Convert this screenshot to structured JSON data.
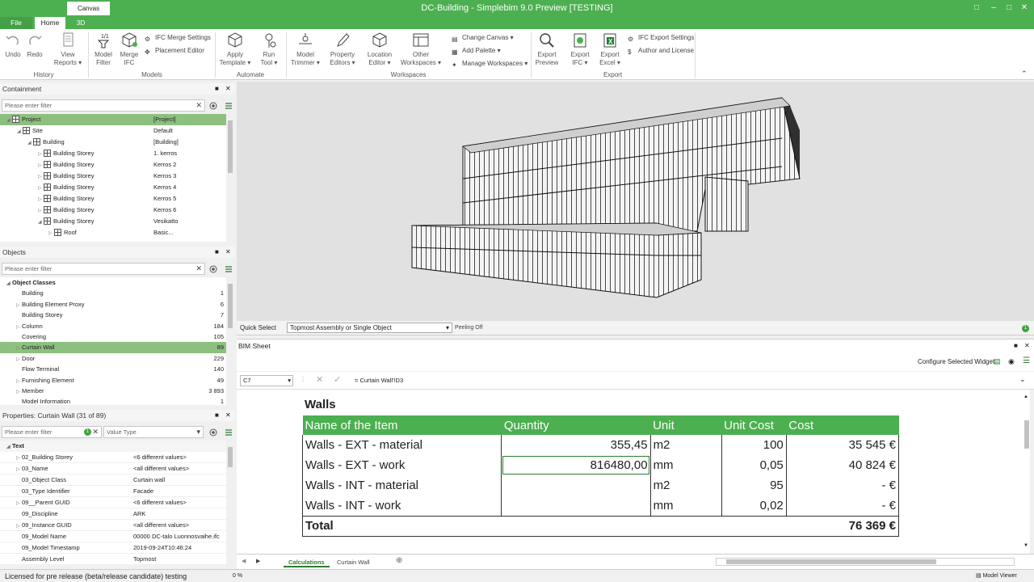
{
  "window": {
    "title": "DC-Building - Simplebim 9.0 Preview [TESTING]",
    "context_tab": "Canvas"
  },
  "ribbon_tabs": [
    "File",
    "Home",
    "3D"
  ],
  "ribbon": {
    "undo": "Undo",
    "redo": "Redo",
    "view_reports": [
      "View",
      "Reports ▾"
    ],
    "model_filter": [
      "Model",
      "Filter"
    ],
    "merge_ifc": [
      "Merge",
      "IFC"
    ],
    "ifc_merge_settings": "IFC Merge Settings",
    "placement_editor": "Placement Editor",
    "apply_template": [
      "Apply",
      "Template ▾"
    ],
    "run_tool": [
      "Run",
      "Tool ▾"
    ],
    "model_trimmer": [
      "Model",
      "Trimmer ▾"
    ],
    "property_editors": [
      "Property",
      "Editors ▾"
    ],
    "location_editor": [
      "Location",
      "Editor ▾"
    ],
    "other_workspaces": [
      "Other",
      "Workspaces ▾"
    ],
    "change_canvas": "Change Canvas ▾",
    "add_palette": "Add Palette ▾",
    "manage_workspaces": "Manage Workspaces ▾",
    "export_preview": [
      "Export",
      "Preview"
    ],
    "export_ifc": [
      "Export",
      "IFC ▾"
    ],
    "export_excel": [
      "Export",
      "Excel ▾"
    ],
    "ifc_export_settings": "IFC Export Settings",
    "author_license": "Author and License",
    "groups": [
      "History",
      "Models",
      "Automate",
      "Workspaces",
      "Export"
    ]
  },
  "containment": {
    "title": "Containment",
    "filter_placeholder": "Please enter filter",
    "rows": [
      {
        "name": "Project",
        "value": "[Project]",
        "indent": 0,
        "tri": "◢"
      },
      {
        "name": "Site",
        "value": "Default",
        "indent": 1,
        "tri": "◢"
      },
      {
        "name": "Building",
        "value": "[Building]",
        "indent": 2,
        "tri": "◢"
      },
      {
        "name": "Building Storey",
        "value": "1. kerros",
        "indent": 3,
        "tri": "▷"
      },
      {
        "name": "Building Storey",
        "value": "Kerros 2",
        "indent": 3,
        "tri": "▷"
      },
      {
        "name": "Building Storey",
        "value": "Kerros 3",
        "indent": 3,
        "tri": "▷"
      },
      {
        "name": "Building Storey",
        "value": "Kerros 4",
        "indent": 3,
        "tri": "▷"
      },
      {
        "name": "Building Storey",
        "value": "Kerros 5",
        "indent": 3,
        "tri": "▷"
      },
      {
        "name": "Building Storey",
        "value": "Kerros 6",
        "indent": 3,
        "tri": "▷"
      },
      {
        "name": "Building Storey",
        "value": "Vesikatto",
        "indent": 3,
        "tri": "◢"
      },
      {
        "name": "Roof",
        "value": "Basic...",
        "indent": 4,
        "tri": "▷"
      }
    ]
  },
  "objects": {
    "title": "Objects",
    "filter_placeholder": "Please enter filter",
    "header": "Object Classes",
    "rows": [
      {
        "name": "Building",
        "count": "1",
        "tri": ""
      },
      {
        "name": "Building Element Proxy",
        "count": "6",
        "tri": "▷"
      },
      {
        "name": "Building Storey",
        "count": "7",
        "tri": ""
      },
      {
        "name": "Column",
        "count": "184",
        "tri": "▷"
      },
      {
        "name": "Covering",
        "count": "105",
        "tri": ""
      },
      {
        "name": "Curtain Wall",
        "count": "89",
        "tri": "▷"
      },
      {
        "name": "Door",
        "count": "229",
        "tri": "▷"
      },
      {
        "name": "Flow Terminal",
        "count": "140",
        "tri": ""
      },
      {
        "name": "Furnishing Element",
        "count": "49",
        "tri": "▷"
      },
      {
        "name": "Member",
        "count": "3 893",
        "tri": "▷"
      },
      {
        "name": "Model Information",
        "count": "1",
        "tri": ""
      }
    ]
  },
  "properties": {
    "title": "Properties: Curtain Wall (31 of 89)",
    "filter_placeholder": "Please enter filter",
    "filter_badge": "1",
    "value_type": "Value Type",
    "section": "Text",
    "rows": [
      {
        "name": "02_Building Storey",
        "value": "<6 different values>",
        "tri": "▷"
      },
      {
        "name": "03_Name",
        "value": "<all different values>",
        "tri": "▷"
      },
      {
        "name": "03_Object Class",
        "value": "Curtain wall",
        "tri": ""
      },
      {
        "name": "03_Type Identifier",
        "value": "Facade",
        "tri": ""
      },
      {
        "name": "09__Parent GUID",
        "value": "<6 different values>",
        "tri": "▷"
      },
      {
        "name": "09_Discipline",
        "value": "ARK",
        "tri": ""
      },
      {
        "name": "09_Instance GUID",
        "value": "<all different values>",
        "tri": "▷"
      },
      {
        "name": "09_Model Name",
        "value": "00000 DC-talo Luonnosvaihe.ifc",
        "tri": ""
      },
      {
        "name": "09_Model Timestamp",
        "value": "2019-09-24T10:46:24",
        "tri": ""
      },
      {
        "name": "Assembly Level",
        "value": "Topmost",
        "tri": ""
      }
    ]
  },
  "quick_select": {
    "label": "Quick Select",
    "value": "Topmost Assembly or Single Object",
    "peeling": "Peeling Off",
    "badge": "1"
  },
  "bim_sheet": {
    "title": "BIM Sheet",
    "configure": "Configure Selected Widget",
    "cell_ref": "C7",
    "formula": "= Curtain Wall'!D3",
    "heading": "Walls",
    "columns": [
      "Name of the Item",
      "Quantity",
      "Unit",
      "Unit Cost",
      "Cost"
    ],
    "rows": [
      [
        "Walls - EXT - material",
        "355,45",
        "m2",
        "100",
        "35 545 €"
      ],
      [
        "Walls - EXT - work",
        "816480,00",
        "mm",
        "0,05",
        "40 824 €"
      ],
      [
        "Walls - INT - material",
        "",
        "m2",
        "95",
        "- €"
      ],
      [
        "Walls - INT - work",
        "",
        "mm",
        "0,02",
        "- €"
      ]
    ],
    "total_label": "Total",
    "total_value": "76 369 €",
    "sheet_tabs": [
      "Calculations",
      "Curtain Wall"
    ]
  },
  "status": {
    "license": "Licensed for pre release (beta/release candidate) testing",
    "progress": "0 %",
    "model_viewer": "Model Viewer"
  },
  "colors": {
    "accent": "#4caf50",
    "selection": "#8dc07f"
  }
}
